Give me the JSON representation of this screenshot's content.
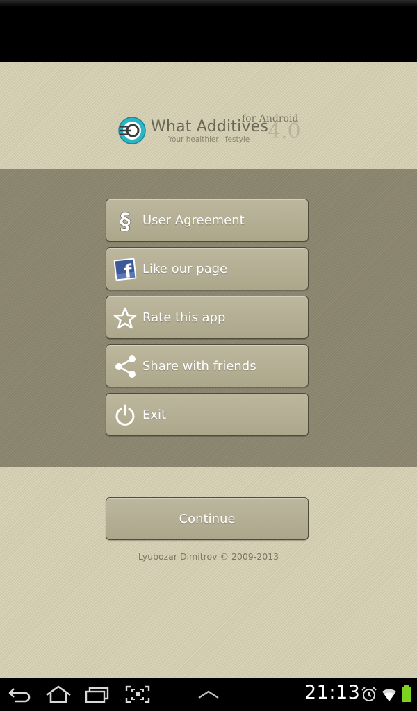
{
  "logo": {
    "name": "What Additives",
    "platform": "for Android",
    "version": "4.0",
    "tagline": "Your healthier lifestyle"
  },
  "menu": {
    "user_agreement": "User Agreement",
    "like_page": "Like our page",
    "rate_app": "Rate this app",
    "share": "Share with friends",
    "exit": "Exit"
  },
  "continue_label": "Continue",
  "copyright": "Lyubozar Dimitrov © 2009-2013",
  "status": {
    "time": "21:13"
  },
  "icons": {
    "user_agreement": "section-sign-icon",
    "like_page": "facebook-icon",
    "rate_app": "star-outline-icon",
    "share": "share-icon",
    "exit": "power-icon",
    "nav": [
      "back-icon",
      "home-icon",
      "recent-apps-icon",
      "screenshot-icon",
      "chevron-up-icon"
    ],
    "status": [
      "alarm-icon",
      "wifi-icon",
      "battery-icon"
    ]
  },
  "colors": {
    "header_bg": "#d6cfb2",
    "menu_band_bg": "#8d8770",
    "button_bg": "#b3ad92",
    "button_border": "#4f4b3d",
    "logo_accent": "#2bb5c7",
    "battery": "#7ed321"
  }
}
